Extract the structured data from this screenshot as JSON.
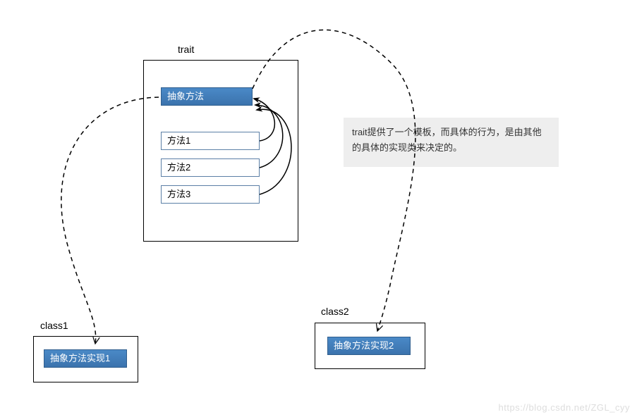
{
  "trait": {
    "title": "trait",
    "abstract_method": "抽象方法",
    "methods": [
      "方法1",
      "方法2",
      "方法3"
    ]
  },
  "class1": {
    "title": "class1",
    "impl": "抽象方法实现1"
  },
  "class2": {
    "title": "class2",
    "impl": "抽象方法实现2"
  },
  "note": {
    "text": "trait提供了一个模板，而具体的行为，是由其他的具体的实现类来决定的。"
  },
  "watermark": "https://blog.csdn.net/ZGL_cyy",
  "colors": {
    "blue_top": "#4a89c7",
    "blue_bottom": "#3b73ad",
    "blue_border": "#2f5e8e",
    "note_bg": "#eeeeee"
  }
}
